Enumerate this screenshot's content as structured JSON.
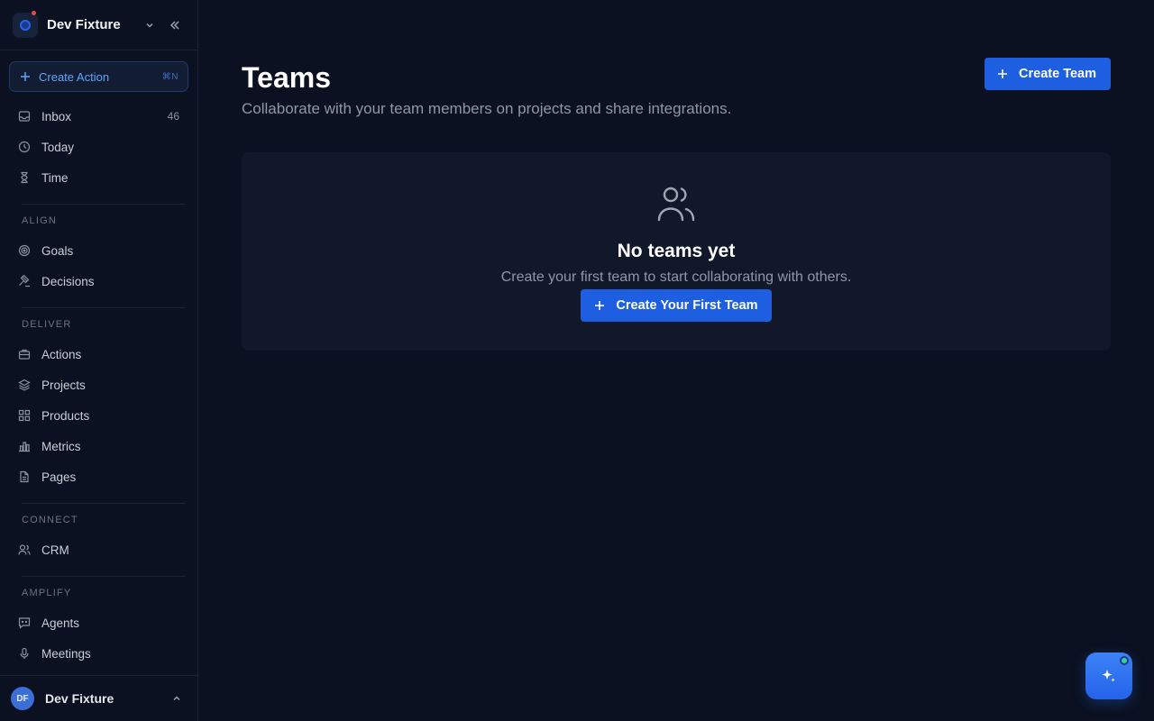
{
  "workspace": {
    "name": "Dev Fixture"
  },
  "create_action": {
    "label": "Create Action",
    "shortcut": "⌘N"
  },
  "nav_top": [
    {
      "label": "Inbox",
      "count": "46",
      "icon": "inbox-icon"
    },
    {
      "label": "Today",
      "icon": "clock-icon"
    },
    {
      "label": "Time",
      "icon": "hourglass-icon"
    }
  ],
  "sections": {
    "align": {
      "label": "ALIGN",
      "items": [
        {
          "label": "Goals"
        },
        {
          "label": "Decisions"
        }
      ]
    },
    "deliver": {
      "label": "DELIVER",
      "items": [
        {
          "label": "Actions"
        },
        {
          "label": "Projects"
        },
        {
          "label": "Products"
        },
        {
          "label": "Metrics"
        },
        {
          "label": "Pages"
        }
      ]
    },
    "connect": {
      "label": "CONNECT",
      "items": [
        {
          "label": "CRM"
        }
      ]
    },
    "amplify": {
      "label": "AMPLIFY",
      "items": [
        {
          "label": "Agents"
        },
        {
          "label": "Meetings"
        }
      ]
    }
  },
  "user": {
    "initials": "DF",
    "name": "Dev Fixture"
  },
  "page": {
    "title": "Teams",
    "subtitle": "Collaborate with your team members on projects and share integrations.",
    "create_button": "Create Team"
  },
  "empty_state": {
    "title": "No teams yet",
    "subtitle": "Create your first team to start collaborating with others.",
    "button": "Create Your First Team"
  },
  "colors": {
    "primary": "#1d5fe0",
    "background": "#0b1120",
    "card": "#111829",
    "status_online": "#34d399"
  }
}
